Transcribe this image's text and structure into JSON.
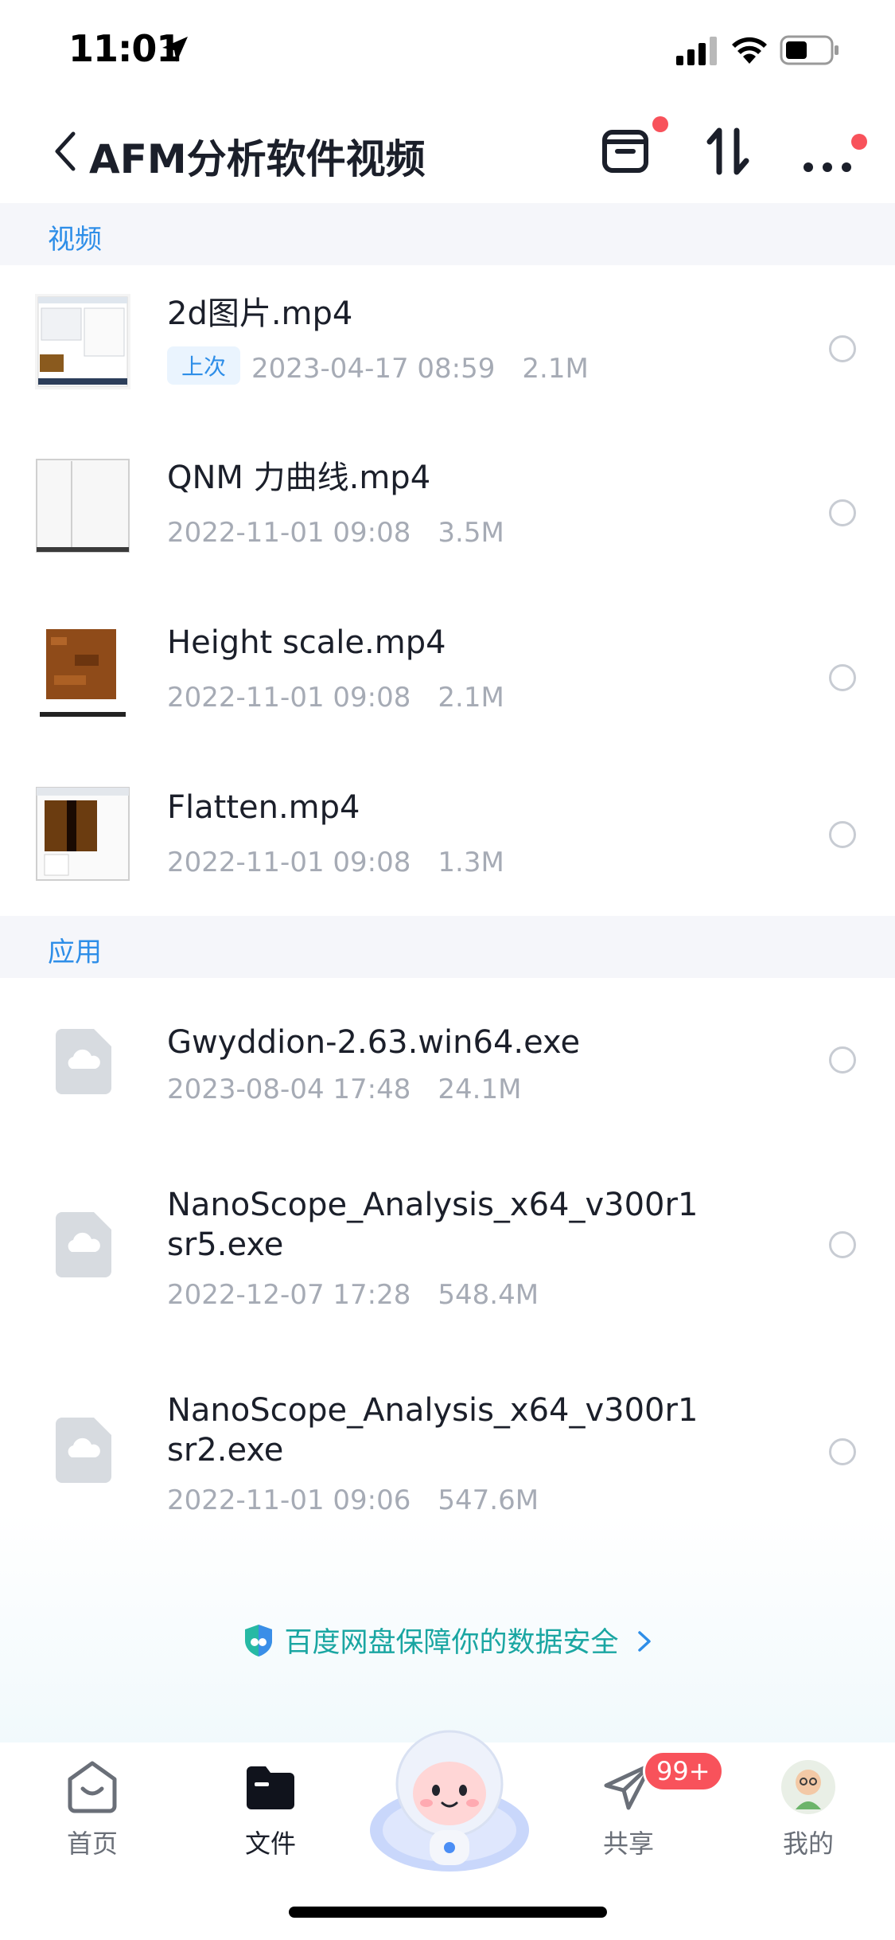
{
  "status": {
    "time": "11:01"
  },
  "header": {
    "title": "AFM分析软件视频"
  },
  "sections": {
    "video": {
      "label": "视频"
    },
    "apps": {
      "label": "应用"
    }
  },
  "videos": [
    {
      "name": "2d图片.mp4",
      "tag": "上次",
      "date": "2023-04-17 08:59",
      "size": "2.1M"
    },
    {
      "name": "QNM 力曲线.mp4",
      "date": "2022-11-01 09:08",
      "size": "3.5M"
    },
    {
      "name": "Height scale.mp4",
      "date": "2022-11-01 09:08",
      "size": "2.1M"
    },
    {
      "name": "Flatten.mp4",
      "date": "2022-11-01 09:08",
      "size": "1.3M"
    }
  ],
  "apps": [
    {
      "name": "Gwyddion-2.63.win64.exe",
      "date": "2023-08-04 17:48",
      "size": "24.1M"
    },
    {
      "name_line1": "NanoScope_Analysis_x64_v300r1",
      "name_line2": "sr5.exe",
      "date": "2022-12-07 17:28",
      "size": "548.4M"
    },
    {
      "name_line1": "NanoScope_Analysis_x64_v300r1",
      "name_line2": "sr2.exe",
      "date": "2022-11-01 09:06",
      "size": "547.6M"
    }
  ],
  "safety_banner": {
    "text": "百度网盘保障你的数据安全"
  },
  "tabbar": {
    "home": "首页",
    "files": "文件",
    "share": "共享",
    "share_badge": "99+",
    "mine": "我的"
  },
  "colors": {
    "accent": "#2e8ee8",
    "badge": "#f8525b",
    "safety": "#1aa6a2"
  }
}
